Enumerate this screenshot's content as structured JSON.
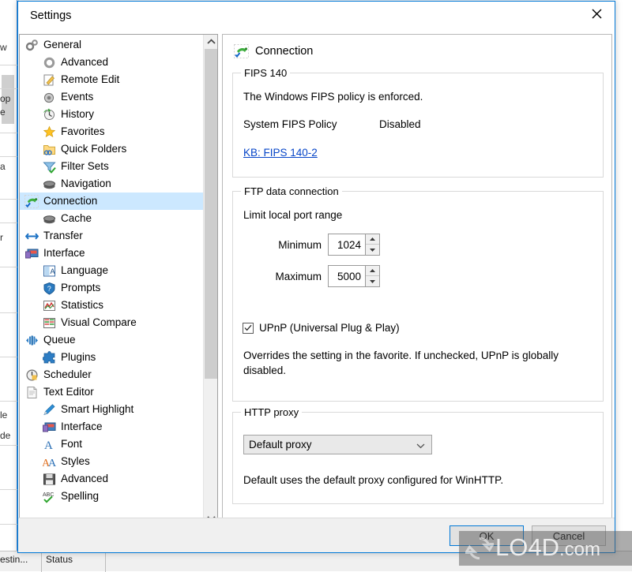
{
  "window": {
    "title": "Settings",
    "close_icon": "close-icon",
    "accent_color": "#0078d7"
  },
  "sidebar": {
    "items": [
      {
        "label": "General",
        "level": 0,
        "icon": "gears-icon",
        "selected": false
      },
      {
        "label": "Advanced",
        "level": 1,
        "icon": "gear-grey-icon",
        "selected": false
      },
      {
        "label": "Remote Edit",
        "level": 1,
        "icon": "pencil-page-icon",
        "selected": false
      },
      {
        "label": "Events",
        "level": 1,
        "icon": "speaker-icon",
        "selected": false
      },
      {
        "label": "History",
        "level": 1,
        "icon": "clock-green-icon",
        "selected": false
      },
      {
        "label": "Favorites",
        "level": 1,
        "icon": "star-icon",
        "selected": false
      },
      {
        "label": "Quick Folders",
        "level": 1,
        "icon": "folder-link-icon",
        "selected": false
      },
      {
        "label": "Filter Sets",
        "level": 1,
        "icon": "funnel-check-icon",
        "selected": false
      },
      {
        "label": "Navigation",
        "level": 1,
        "icon": "disc-stack-icon",
        "selected": false
      },
      {
        "label": "Connection",
        "level": 0,
        "icon": "plug-check-icon",
        "selected": true
      },
      {
        "label": "Cache",
        "level": 1,
        "icon": "disc-stack-icon",
        "selected": false
      },
      {
        "label": "Transfer",
        "level": 0,
        "icon": "arrows-lr-icon",
        "selected": false
      },
      {
        "label": "Interface",
        "level": 0,
        "icon": "monitor-icon",
        "selected": false
      },
      {
        "label": "Language",
        "level": 1,
        "icon": "language-icon",
        "selected": false
      },
      {
        "label": "Prompts",
        "level": 1,
        "icon": "shield-question-icon",
        "selected": false
      },
      {
        "label": "Statistics",
        "level": 1,
        "icon": "chart-icon",
        "selected": false
      },
      {
        "label": "Visual Compare",
        "level": 1,
        "icon": "compare-icon",
        "selected": false
      },
      {
        "label": "Queue",
        "level": 0,
        "icon": "queue-icon",
        "selected": false
      },
      {
        "label": "Plugins",
        "level": 1,
        "icon": "puzzle-icon",
        "selected": false
      },
      {
        "label": "Scheduler",
        "level": 0,
        "icon": "clock-icon",
        "selected": false
      },
      {
        "label": "Text Editor",
        "level": 0,
        "icon": "document-icon",
        "selected": false
      },
      {
        "label": "Smart Highlight",
        "level": 1,
        "icon": "pen-icon",
        "selected": false
      },
      {
        "label": "Interface",
        "level": 1,
        "icon": "monitor-icon",
        "selected": false
      },
      {
        "label": "Font",
        "level": 1,
        "icon": "font-a-icon",
        "selected": false
      },
      {
        "label": "Styles",
        "level": 1,
        "icon": "styles-aa-icon",
        "selected": false
      },
      {
        "label": "Advanced",
        "level": 1,
        "icon": "floppy-icon",
        "selected": false
      },
      {
        "label": "Spelling",
        "level": 1,
        "icon": "abc-check-icon",
        "selected": false
      }
    ],
    "scrollbar": {
      "up_icon": "chevron-up-icon",
      "down_icon": "chevron-down-icon"
    }
  },
  "content": {
    "header": {
      "title": "Connection",
      "icon": "plug-check-icon"
    },
    "fips_group": {
      "title": "FIPS 140",
      "description": "The Windows FIPS policy is enforced.",
      "policy_label": "System FIPS Policy",
      "policy_value": "Disabled",
      "link_text": "KB: FIPS 140-2"
    },
    "ftp_group": {
      "title": "FTP data connection",
      "range_label": "Limit local port range",
      "minimum_label": "Minimum",
      "minimum_value": "1024",
      "maximum_label": "Maximum",
      "maximum_value": "5000",
      "upnp_label": "UPnP (Universal Plug & Play)",
      "upnp_checked": true,
      "upnp_help": "Overrides the setting in the favorite. If unchecked, UPnP is globally disabled."
    },
    "proxy_group": {
      "title": "HTTP proxy",
      "selected_option": "Default proxy",
      "options": [
        "Default proxy"
      ],
      "help": "Default uses the default proxy configured for WinHTTP."
    }
  },
  "footer": {
    "ok_label": "OK",
    "cancel_label": "Cancel"
  },
  "watermark": {
    "text": "LO4D",
    "suffix": ".com",
    "logo_icon": "refresh-circle-icon"
  },
  "background": {
    "fragments": [
      "w",
      "op",
      "e",
      "a",
      "r",
      "le",
      "de"
    ],
    "status_segments": [
      "estin...",
      "Status"
    ]
  }
}
